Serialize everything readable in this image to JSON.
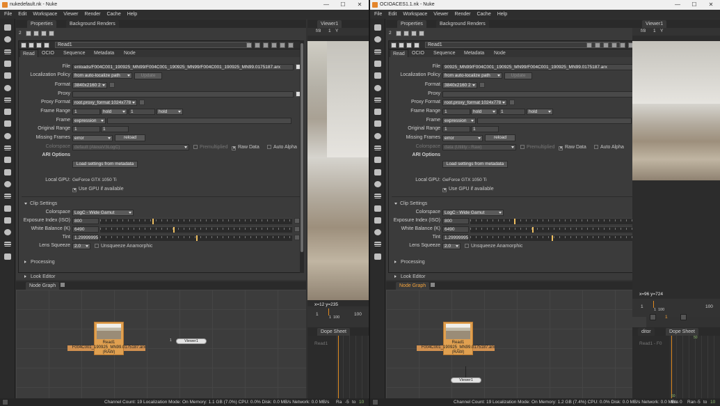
{
  "windows": [
    {
      "id": "left",
      "title": "nukedefault.nk - Nuke",
      "title_controls": [
        "—",
        "☐",
        "✕"
      ],
      "menu": [
        "File",
        "Edit",
        "Workspace",
        "Viewer",
        "Render",
        "Cache",
        "Help"
      ],
      "panel_tabs": [
        "Properties",
        "Background Renders"
      ],
      "properties_count": "2",
      "node_name": "Read1",
      "node_tabs": [
        "Read",
        "OCIO",
        "Sequence",
        "Metadata",
        "Node"
      ],
      "file_label": "File",
      "file_value": "enloads/F004C001_190925_MN99/F004C001_190925_MN99/F004C001_190925_MN99.0175187.arx",
      "localization_label": "Localization Policy",
      "localization_value": "from auto-localize path",
      "update_label": "Update",
      "format_label": "Format",
      "format_value": "3840x2160 2",
      "proxy_label": "Proxy",
      "proxy_format_label": "Proxy Format",
      "proxy_format_value": "root.proxy_format 1024x778",
      "frame_range_label": "Frame Range",
      "frame_range_start": "1",
      "frame_range_start_mode": "hold",
      "frame_range_end": "1",
      "frame_range_end_mode": "hold",
      "frame_label": "Frame",
      "frame_mode": "expression",
      "original_range_label": "Original Range",
      "original_range_start": "1",
      "original_range_end": "1",
      "missing_frames_label": "Missing Frames",
      "missing_frames_value": "error",
      "reload_label": "reload",
      "colorspace_label": "Colorspace",
      "colorspace_value": "default (AlexaV3LogC)",
      "premultiplied_label": "Premultiplied",
      "raw_data_label": "Raw Data",
      "auto_alpha_label": "Auto Alpha",
      "ari_options_label": "ARI Options",
      "load_settings_label": "Load settings from metadata",
      "local_gpu_label": "Local GPU:",
      "local_gpu_value": "GeForce GTX 1050 Ti",
      "use_gpu_label": "Use GPU if available",
      "clip_settings_label": "Clip Settings",
      "clip_colorspace_label": "Colorspace",
      "clip_colorspace_value": "LogC - Wide Gamut",
      "exposure_label": "Exposure Index (ISO)",
      "exposure_value": "800",
      "exposure_fraction": 0.27,
      "white_balance_label": "White Balance (K)",
      "white_balance_value": "6490",
      "white_balance_fraction": 0.38,
      "tint_label": "Tint",
      "tint_value": "1.29999995",
      "tint_fraction": 0.5,
      "lens_squeeze_label": "Lens Squeeze",
      "lens_squeeze_value": "2.0",
      "unsqueeze_label": "Unsqueeze Anamorphic",
      "processing_label": "Processing",
      "look_editor_label": "Look Editor",
      "node_graph_tab": "Node Graph",
      "graph_node_label": "Read1",
      "graph_node_file": "F004C001_190925_MN99.0175187.arx",
      "graph_node_type": "(RAW)",
      "graph_viewer_label": "Viewer1",
      "graph_input_number": "1",
      "viewer_tab": "Viewer1",
      "viewer_fstop": "f/8",
      "viewer_frame": "1",
      "viewer_y": "Y",
      "viewer_coords": "x=12 y=235",
      "timeline_start": "1",
      "timeline_mid": "1",
      "timeline_mark": "100",
      "timeline_end": "100",
      "dope_sheet_tab": "Dope Sheet",
      "dope_row": "Read1",
      "status_text": "Channel Count: 19  Localization Mode: On  Memory: 1.1 GB (7.0%)  CPU: 0.0%  Disk: 0.0 MB/s  Network: 0.0 MB/s",
      "bottom_ra": "Ra",
      "bottom_minus5": "-5",
      "bottom_to": "to",
      "bottom_last": "10"
    },
    {
      "id": "right",
      "title": "OCIOACES1.1.nk - Nuke",
      "title_controls": [
        "—",
        "☐",
        "✕"
      ],
      "menu": [
        "File",
        "Edit",
        "Workspace",
        "Viewer",
        "Render",
        "Cache",
        "Help"
      ],
      "panel_tabs": [
        "Properties",
        "Background Renders"
      ],
      "properties_count": "2",
      "node_name": "Read1",
      "node_tabs": [
        "Read",
        "OCIO",
        "Sequence",
        "Metadata",
        "Node"
      ],
      "file_label": "File",
      "file_value": "90925_MN99/F004C001_190925_MN99/F004C001_190925_MN99.0175187.arx",
      "localization_label": "Localization Policy",
      "localization_value": "from auto-localize path",
      "update_label": "Update",
      "format_label": "Format",
      "format_value": "3840x2160 2",
      "proxy_label": "Proxy",
      "proxy_format_label": "Proxy Format",
      "proxy_format_value": "root.proxy_format 1024x778",
      "frame_range_label": "Frame Range",
      "frame_range_start": "1",
      "frame_range_start_mode": "hold",
      "frame_range_end": "1",
      "frame_range_end_mode": "hold",
      "frame_label": "Frame",
      "frame_mode": "expression",
      "original_range_label": "Original Range",
      "original_range_start": "1",
      "original_range_end": "1",
      "missing_frames_label": "Missing Frames",
      "missing_frames_value": "error",
      "reload_label": "reload",
      "colorspace_label": "Colorspace",
      "colorspace_value": "data (Utility - Raw)",
      "premultiplied_label": "Premultiplied",
      "raw_data_label": "Raw Data",
      "auto_alpha_label": "Auto Alpha",
      "ari_options_label": "ARI Options",
      "load_settings_label": "Load settings from metadata",
      "local_gpu_label": "Local GPU:",
      "local_gpu_value": "GeForce GTX 1050 Ti",
      "use_gpu_label": "Use GPU if available",
      "clip_settings_label": "Clip Settings",
      "clip_colorspace_label": "Colorspace",
      "clip_colorspace_value": "LogC - Wide Gamut",
      "exposure_label": "Exposure Index (ISO)",
      "exposure_value": "800",
      "exposure_fraction": 0.27,
      "white_balance_label": "White Balance (K)",
      "white_balance_value": "6490",
      "white_balance_fraction": 0.38,
      "tint_label": "Tint",
      "tint_value": "1.29999995",
      "tint_fraction": 0.5,
      "lens_squeeze_label": "Lens Squeeze",
      "lens_squeeze_value": "2.0",
      "unsqueeze_label": "Unsqueeze Anamorphic",
      "processing_label": "Processing",
      "look_editor_label": "Look Editor",
      "node_graph_tab": "Node Graph",
      "graph_node_label": "Read1",
      "graph_node_file": "F004C001_190925_MN99.0175187.arx",
      "graph_node_type": "(RAW)",
      "graph_viewer_label": "Viewer1",
      "graph_input_number": "1",
      "viewer_tab": "Viewer1",
      "viewer_fstop": "f/8",
      "viewer_frame": "1",
      "viewer_y": "Y",
      "viewer_coords": "x=96 y=724",
      "timeline_start": "1",
      "timeline_mid": "1",
      "timeline_mark": "100",
      "timeline_end": "100",
      "dope_sheet_tab": "Dope Sheet",
      "dope_side_tab": "ditor",
      "dope_row": "Read1 - F0",
      "dope_value_top": "50",
      "dope_value_bottom": "50",
      "status_text": "Channel Count: 19  Localization Mode: On  Memory: 1.2 GB (7.4%)  CPU: 0.0%  Disk: 0.0 MB/s  Network: 0.0 MB/s",
      "bottom_fov": "fov",
      "bottom_0": "0",
      "bottom_ra": "Ran",
      "bottom_minus5": "-5",
      "bottom_to": "to",
      "bottom_last": "10"
    }
  ],
  "icons": [
    "nuke-logo-icon",
    "minimize-icon",
    "maximize-icon",
    "close-icon",
    "float-panel-icon",
    "lock-icon",
    "clear-icon",
    "pencil-icon",
    "checkbox-icon",
    "dropdown-arrow-icon",
    "file-browse-icon",
    "animation-menu-icon",
    "collapse-triangle-icon"
  ],
  "colors": {
    "accent_orange": "#f3a23a",
    "read_node": "#e0a050",
    "timeline_cursor": "#e08a20"
  }
}
